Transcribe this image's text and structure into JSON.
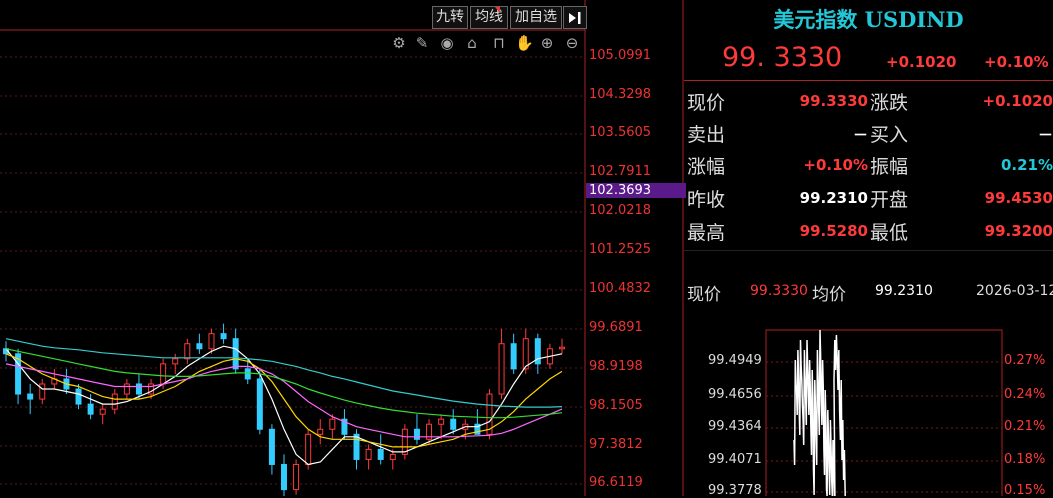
{
  "toolbar": {
    "jiuzhuan": "九转",
    "junxian": "均线",
    "add_watch": "加自选",
    "collapse_icon": "collapse-right-icon",
    "tools": [
      "settings-icon",
      "pencil-icon",
      "eye-icon",
      "basket-icon",
      "lock-icon",
      "hand-icon",
      "zoom-in-icon",
      "zoom-out-icon"
    ]
  },
  "chart_data": {
    "type": "candlestick",
    "y_ticks": [
      "105.0991",
      "104.3298",
      "103.5605",
      "102.7911",
      "102.0218",
      "101.2525",
      "100.4832",
      "99.6891",
      "98.9198",
      "98.1505",
      "97.3812",
      "96.6119"
    ],
    "current_marker": "102.3693",
    "ylim": [
      96.6119,
      105.0991
    ],
    "candles": [
      [
        99.3,
        99.45,
        99.05,
        99.2
      ],
      [
        99.2,
        99.3,
        98.2,
        98.4
      ],
      [
        98.4,
        98.6,
        98.0,
        98.3
      ],
      [
        98.3,
        98.7,
        98.2,
        98.6
      ],
      [
        98.6,
        98.9,
        98.5,
        98.7
      ],
      [
        98.7,
        98.9,
        98.4,
        98.5
      ],
      [
        98.5,
        98.6,
        98.1,
        98.2
      ],
      [
        98.2,
        98.4,
        97.9,
        98.0
      ],
      [
        98.0,
        98.2,
        97.8,
        98.1
      ],
      [
        98.1,
        98.5,
        98.0,
        98.4
      ],
      [
        98.4,
        98.7,
        98.3,
        98.6
      ],
      [
        98.6,
        98.8,
        98.3,
        98.4
      ],
      [
        98.4,
        98.7,
        98.3,
        98.6
      ],
      [
        98.6,
        99.1,
        98.5,
        99.0
      ],
      [
        99.0,
        99.2,
        98.8,
        99.1
      ],
      [
        99.1,
        99.5,
        99.0,
        99.4
      ],
      [
        99.4,
        99.6,
        99.2,
        99.3
      ],
      [
        99.3,
        99.7,
        99.2,
        99.6
      ],
      [
        99.6,
        99.8,
        99.4,
        99.5
      ],
      [
        99.5,
        99.7,
        98.8,
        98.9
      ],
      [
        98.9,
        99.1,
        98.6,
        98.7
      ],
      [
        98.7,
        98.9,
        97.6,
        97.7
      ],
      [
        97.7,
        97.8,
        96.8,
        97.0
      ],
      [
        97.0,
        97.2,
        96.3,
        96.5
      ],
      [
        96.5,
        97.1,
        96.4,
        97.0
      ],
      [
        97.0,
        97.7,
        96.9,
        97.6
      ],
      [
        97.6,
        97.9,
        97.4,
        97.7
      ],
      [
        97.7,
        98.0,
        97.5,
        97.9
      ],
      [
        97.9,
        98.1,
        97.5,
        97.6
      ],
      [
        97.6,
        97.7,
        96.9,
        97.1
      ],
      [
        97.1,
        97.4,
        96.9,
        97.3
      ],
      [
        97.3,
        97.6,
        97.0,
        97.1
      ],
      [
        97.1,
        97.3,
        96.9,
        97.2
      ],
      [
        97.2,
        97.8,
        97.1,
        97.7
      ],
      [
        97.7,
        98.0,
        97.4,
        97.5
      ],
      [
        97.5,
        97.9,
        97.4,
        97.8
      ],
      [
        97.8,
        98.0,
        97.5,
        97.9
      ],
      [
        97.9,
        98.1,
        97.6,
        97.7
      ],
      [
        97.7,
        97.9,
        97.5,
        97.8
      ],
      [
        97.8,
        98.1,
        97.6,
        97.6
      ],
      [
        97.6,
        98.5,
        97.5,
        98.4
      ],
      [
        98.4,
        99.7,
        98.3,
        99.4
      ],
      [
        99.4,
        99.6,
        98.8,
        98.9
      ],
      [
        98.9,
        99.7,
        98.8,
        99.5
      ],
      [
        99.5,
        99.6,
        98.8,
        99.0
      ],
      [
        99.0,
        99.4,
        98.9,
        99.3
      ],
      [
        99.3,
        99.5,
        99.2,
        99.33
      ]
    ],
    "ma_lines": [
      {
        "color": "#ffffff",
        "values": [
          99.3,
          99.0,
          98.7,
          98.5,
          98.5,
          98.45,
          98.4,
          98.3,
          98.2,
          98.2,
          98.25,
          98.35,
          98.45,
          98.6,
          98.75,
          98.95,
          99.1,
          99.25,
          99.35,
          99.3,
          99.1,
          98.8,
          98.3,
          97.7,
          97.2,
          97.0,
          97.05,
          97.3,
          97.55,
          97.55,
          97.45,
          97.35,
          97.25,
          97.25,
          97.35,
          97.45,
          97.55,
          97.65,
          97.75,
          97.75,
          97.85,
          98.2,
          98.6,
          98.95,
          99.1,
          99.15,
          99.2
        ]
      },
      {
        "color": "#ffd700",
        "values": [
          99.2,
          99.1,
          98.95,
          98.8,
          98.7,
          98.6,
          98.55,
          98.45,
          98.35,
          98.3,
          98.3,
          98.3,
          98.35,
          98.45,
          98.55,
          98.7,
          98.85,
          98.95,
          99.05,
          99.1,
          99.05,
          98.9,
          98.65,
          98.3,
          97.95,
          97.7,
          97.55,
          97.5,
          97.5,
          97.5,
          97.45,
          97.4,
          97.35,
          97.35,
          97.35,
          97.4,
          97.45,
          97.5,
          97.6,
          97.65,
          97.7,
          97.85,
          98.05,
          98.3,
          98.5,
          98.7,
          98.85
        ]
      },
      {
        "color": "#ff66ff",
        "values": [
          99.0,
          98.95,
          98.9,
          98.85,
          98.8,
          98.75,
          98.7,
          98.65,
          98.6,
          98.55,
          98.55,
          98.55,
          98.55,
          98.6,
          98.65,
          98.7,
          98.78,
          98.85,
          98.9,
          98.95,
          98.95,
          98.9,
          98.8,
          98.65,
          98.45,
          98.25,
          98.1,
          97.95,
          97.85,
          97.75,
          97.7,
          97.65,
          97.6,
          97.55,
          97.55,
          97.55,
          97.55,
          97.55,
          97.56,
          97.57,
          97.58,
          97.62,
          97.7,
          97.8,
          97.9,
          98.0,
          98.1
        ]
      },
      {
        "color": "#33dd33",
        "values": [
          99.3,
          99.25,
          99.2,
          99.15,
          99.1,
          99.05,
          99.0,
          98.95,
          98.9,
          98.85,
          98.82,
          98.8,
          98.78,
          98.76,
          98.75,
          98.75,
          98.76,
          98.78,
          98.8,
          98.82,
          98.82,
          98.8,
          98.75,
          98.68,
          98.6,
          98.5,
          98.42,
          98.35,
          98.28,
          98.22,
          98.17,
          98.12,
          98.08,
          98.05,
          98.02,
          98.0,
          97.98,
          97.96,
          97.95,
          97.94,
          97.93,
          97.93,
          97.94,
          97.96,
          97.98,
          98.0,
          98.03
        ]
      },
      {
        "color": "#33cccc",
        "values": [
          99.5,
          99.45,
          99.4,
          99.35,
          99.32,
          99.3,
          99.28,
          99.25,
          99.22,
          99.2,
          99.18,
          99.16,
          99.14,
          99.12,
          99.12,
          99.12,
          99.12,
          99.12,
          99.12,
          99.12,
          99.1,
          99.08,
          99.05,
          99.0,
          98.95,
          98.88,
          98.82,
          98.75,
          98.7,
          98.64,
          98.58,
          98.52,
          98.46,
          98.42,
          98.38,
          98.34,
          98.3,
          98.26,
          98.23,
          98.2,
          98.18,
          98.16,
          98.15,
          98.14,
          98.14,
          98.14,
          98.15
        ]
      }
    ]
  },
  "quote": {
    "title": "美元指数 USDIND",
    "price": "99. 3330",
    "change": "+0.1020",
    "change_pct": "+0.10%",
    "rows": [
      {
        "l1": "现价",
        "v1": "99.3330",
        "c1": "red",
        "l2": "涨跌",
        "v2": "+0.1020",
        "c2": "red"
      },
      {
        "l1": "卖出",
        "v1": "－",
        "c1": "white",
        "l2": "买入",
        "v2": "－",
        "c2": "white"
      },
      {
        "l1": "涨幅",
        "v1": "+0.10%",
        "c1": "red",
        "l2": "振幅",
        "v2": "0.21%",
        "c2": "cyan"
      },
      {
        "l1": "昨收",
        "v1": "99.2310",
        "c1": "white",
        "l2": "开盘",
        "v2": "99.4530",
        "c2": "red"
      },
      {
        "l1": "最高",
        "v1": "99.5280",
        "c1": "red",
        "l2": "最低",
        "v2": "99.3200",
        "c2": "red"
      }
    ]
  },
  "intraday": {
    "price_label": "现价",
    "price_value": "99.3330",
    "avg_label": "均价",
    "avg_value": "99.2310",
    "date": "2026-03-12",
    "left_ticks": [
      "99.4949",
      "99.4656",
      "99.4364",
      "99.4071",
      "99.3778"
    ],
    "right_ticks": [
      "0.27%",
      "0.24%",
      "0.21%",
      "0.18%",
      "0.15%"
    ]
  }
}
